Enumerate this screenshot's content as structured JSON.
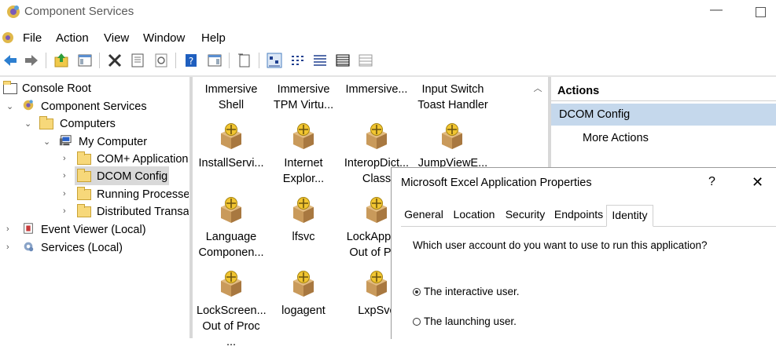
{
  "window": {
    "title": "Component Services"
  },
  "menu": [
    "File",
    "Action",
    "View",
    "Window",
    "Help"
  ],
  "tree": {
    "console_root": "Console Root",
    "component_services": "Component Services",
    "computers": "Computers",
    "my_computer": "My Computer",
    "com_plus": "COM+ Applications",
    "dcom_config": "DCOM Config",
    "running_processes": "Running Processes",
    "distributed_trans": "Distributed Transaction Coordinator",
    "event_viewer": "Event Viewer (Local)",
    "services": "Services (Local)"
  },
  "content": {
    "row1": [
      {
        "l1": "Immersive",
        "l2": "Shell"
      },
      {
        "l1": "Immersive",
        "l2": "TPM Virtu..."
      },
      {
        "l1": "Immersive...",
        "l2": ""
      },
      {
        "l1": "Input Switch",
        "l2": "Toast Handler"
      }
    ],
    "row2": [
      {
        "l1": "InstallServi...",
        "l2": ""
      },
      {
        "l1": "Internet",
        "l2": "Explor..."
      },
      {
        "l1": "InteropDict...",
        "l2": "Class"
      },
      {
        "l1": "JumpViewE...",
        "l2": ""
      }
    ],
    "row3": [
      {
        "l1": "Language",
        "l2": "Componen..."
      },
      {
        "l1": "lfsvc",
        "l2": ""
      },
      {
        "l1": "LockApph...",
        "l2": "Out of Pr..."
      }
    ],
    "row4": [
      {
        "l1": "LockScreen...",
        "l2": "Out of Proc ..."
      },
      {
        "l1": "logagent",
        "l2": ""
      },
      {
        "l1": "LxpSvc",
        "l2": ""
      }
    ]
  },
  "actions": {
    "header": "Actions",
    "selected": "DCOM Config",
    "more": "More Actions"
  },
  "dialog": {
    "title": "Microsoft Excel Application Properties",
    "help": "?",
    "close": "✕",
    "tabs": [
      "General",
      "Location",
      "Security",
      "Endpoints",
      "Identity"
    ],
    "active_tab": "Identity",
    "question": "Which user account do you want to use to run this application?",
    "options": [
      {
        "label": "The interactive user.",
        "selected": true
      },
      {
        "label": "The launching user.",
        "selected": false
      }
    ]
  },
  "colors": {
    "selection": "#c5d8ec",
    "tree_selected": "#d9d9d9",
    "folder": "#f7d87a"
  }
}
